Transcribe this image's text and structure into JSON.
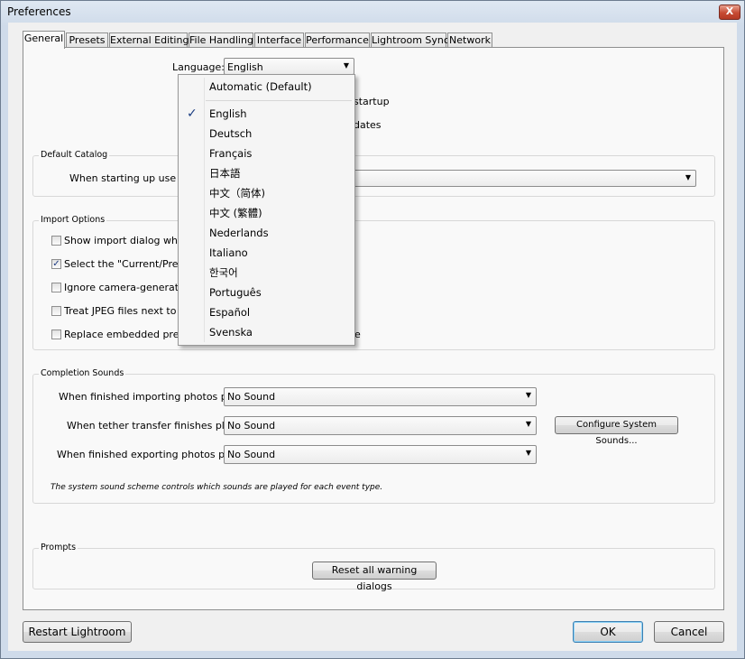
{
  "window": {
    "title": "Preferences",
    "close_symbol": "X"
  },
  "tabs": [
    "General",
    "Presets",
    "External Editing",
    "File Handling",
    "Interface",
    "Performance",
    "Lightroom Sync",
    "Network"
  ],
  "language": {
    "label": "Language:",
    "value": "English",
    "options": [
      "Automatic (Default)",
      "English",
      "Deutsch",
      "Français",
      "日本語",
      "中文（简体)",
      "中文 (繁體)",
      "Nederlands",
      "Italiano",
      "한국어",
      "Português",
      "Español",
      "Svenska"
    ],
    "selected": "English",
    "check_symbol": "✓"
  },
  "settings_partial": {
    "startup": "startup",
    "updates": "dates"
  },
  "default_catalog": {
    "legend": "Default Catalog",
    "label": "When starting up use this"
  },
  "import_options": {
    "legend": "Import Options",
    "items": [
      {
        "label": "Show import dialog when a",
        "checked": false
      },
      {
        "label": "Select the \"Current/Previo",
        "checked": true
      },
      {
        "label": "Ignore camera-generated",
        "checked": false
      },
      {
        "label": "Treat JPEG files next to ra",
        "checked": false
      },
      {
        "label": "Replace embedded preview",
        "checked": false
      }
    ],
    "trailing_e": "e"
  },
  "completion_sounds": {
    "legend": "Completion Sounds",
    "importing_label": "When finished importing photos play:",
    "importing_value": "No Sound",
    "tether_label": "When tether transfer finishes play:",
    "tether_value": "No Sound",
    "exporting_label": "When finished exporting photos play:",
    "exporting_value": "No Sound",
    "configure_button": "Configure System Sounds...",
    "note": "The system sound scheme controls which sounds are played for each event type."
  },
  "prompts": {
    "legend": "Prompts",
    "reset_button": "Reset all warning dialogs"
  },
  "footer": {
    "restart_button": "Restart Lightroom",
    "ok_button": "OK",
    "cancel_button": "Cancel"
  }
}
